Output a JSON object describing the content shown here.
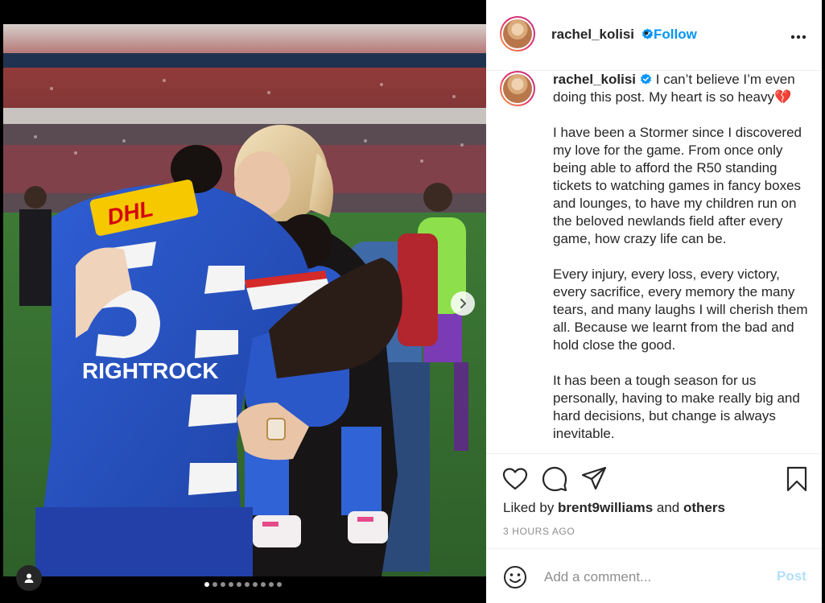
{
  "post": {
    "username": "rachel_kolisi",
    "follow_label": "Follow",
    "bullet": "•",
    "more_label": "•••",
    "caption_paragraphs": [
      "I can’t believe I’m even doing this post. My heart is so heavy💔",
      "I have been a Stormer since I discovered my love for the game. From once only being able to afford the R50 standing tickets to watching games in fancy boxes and lounges, to have my children run on the beloved newlands field after every game, how crazy life can be.",
      "Every injury, every loss, every victory, every sacrifice, every memory the many tears, and many laughs I will cherish them all. Because we learnt from the bad and hold close the good.",
      "It has been a tough season for us personally, having to make really big and hard decisions, but change is always inevitable."
    ],
    "liked_prefix": "Liked by ",
    "liked_user": "brent9williams",
    "liked_middle": " and ",
    "liked_others": "others",
    "time_ago": "3 HOURS AGO",
    "comment_placeholder": "Add a comment...",
    "post_label": "Post"
  },
  "media": {
    "jersey_text": "RIGHTROCK",
    "sponsor_text": "DHL",
    "carousel_count": 10,
    "carousel_active_index": 0
  },
  "colors": {
    "accent": "#0095f6",
    "post_disabled": "#b2dffc",
    "text": "#262626",
    "muted": "#8e8e8e",
    "jersey_blue": "#2a55c8"
  },
  "icons": {
    "verified": "verified-badge-icon",
    "like": "heart-icon",
    "comment": "comment-bubble-icon",
    "share": "paper-plane-icon",
    "save": "bookmark-icon",
    "emoji": "smiley-icon",
    "user_tag": "user-tag-icon",
    "next": "chevron-right-icon"
  }
}
